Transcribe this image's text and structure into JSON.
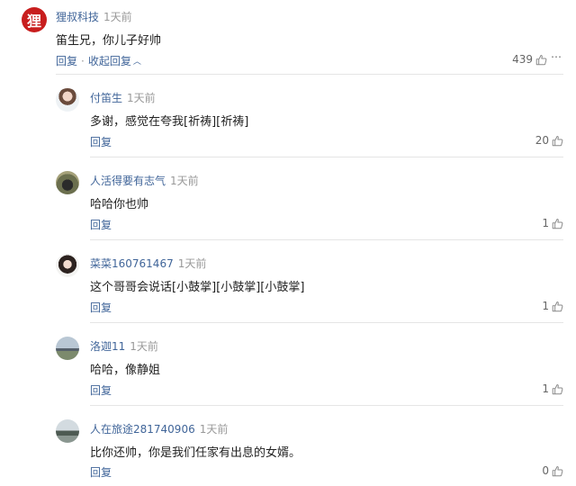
{
  "root_comment": {
    "avatar_char": "狸",
    "user": "狸叔科技",
    "time": "1天前",
    "content": "笛生兄，你儿子好帅",
    "reply_label": "回复",
    "separator": "·",
    "collapse_label": "收起回复",
    "likes": "439"
  },
  "replies": [
    {
      "user": "付笛生",
      "time": "1天前",
      "content": "多谢，感觉在夸我[祈祷][祈祷]",
      "reply_label": "回复",
      "likes": "20"
    },
    {
      "user": "人活得要有志气",
      "time": "1天前",
      "content": "哈哈你也帅",
      "reply_label": "回复",
      "likes": "1"
    },
    {
      "user": "菜菜160761467",
      "time": "1天前",
      "content": "这个哥哥会说话[小鼓掌][小鼓掌][小鼓掌]",
      "reply_label": "回复",
      "likes": "1"
    },
    {
      "user": "洛迦11",
      "time": "1天前",
      "content": "哈哈，像静姐",
      "reply_label": "回复",
      "likes": "1"
    },
    {
      "user": "人在旅途281740906",
      "time": "1天前",
      "content": "比你还帅，你是我们任家有出息的女婿。",
      "reply_label": "回复",
      "likes": "0"
    }
  ],
  "colors": {
    "link": "#406599",
    "brand_avatar": "#c81e1e",
    "muted": "#999999"
  }
}
